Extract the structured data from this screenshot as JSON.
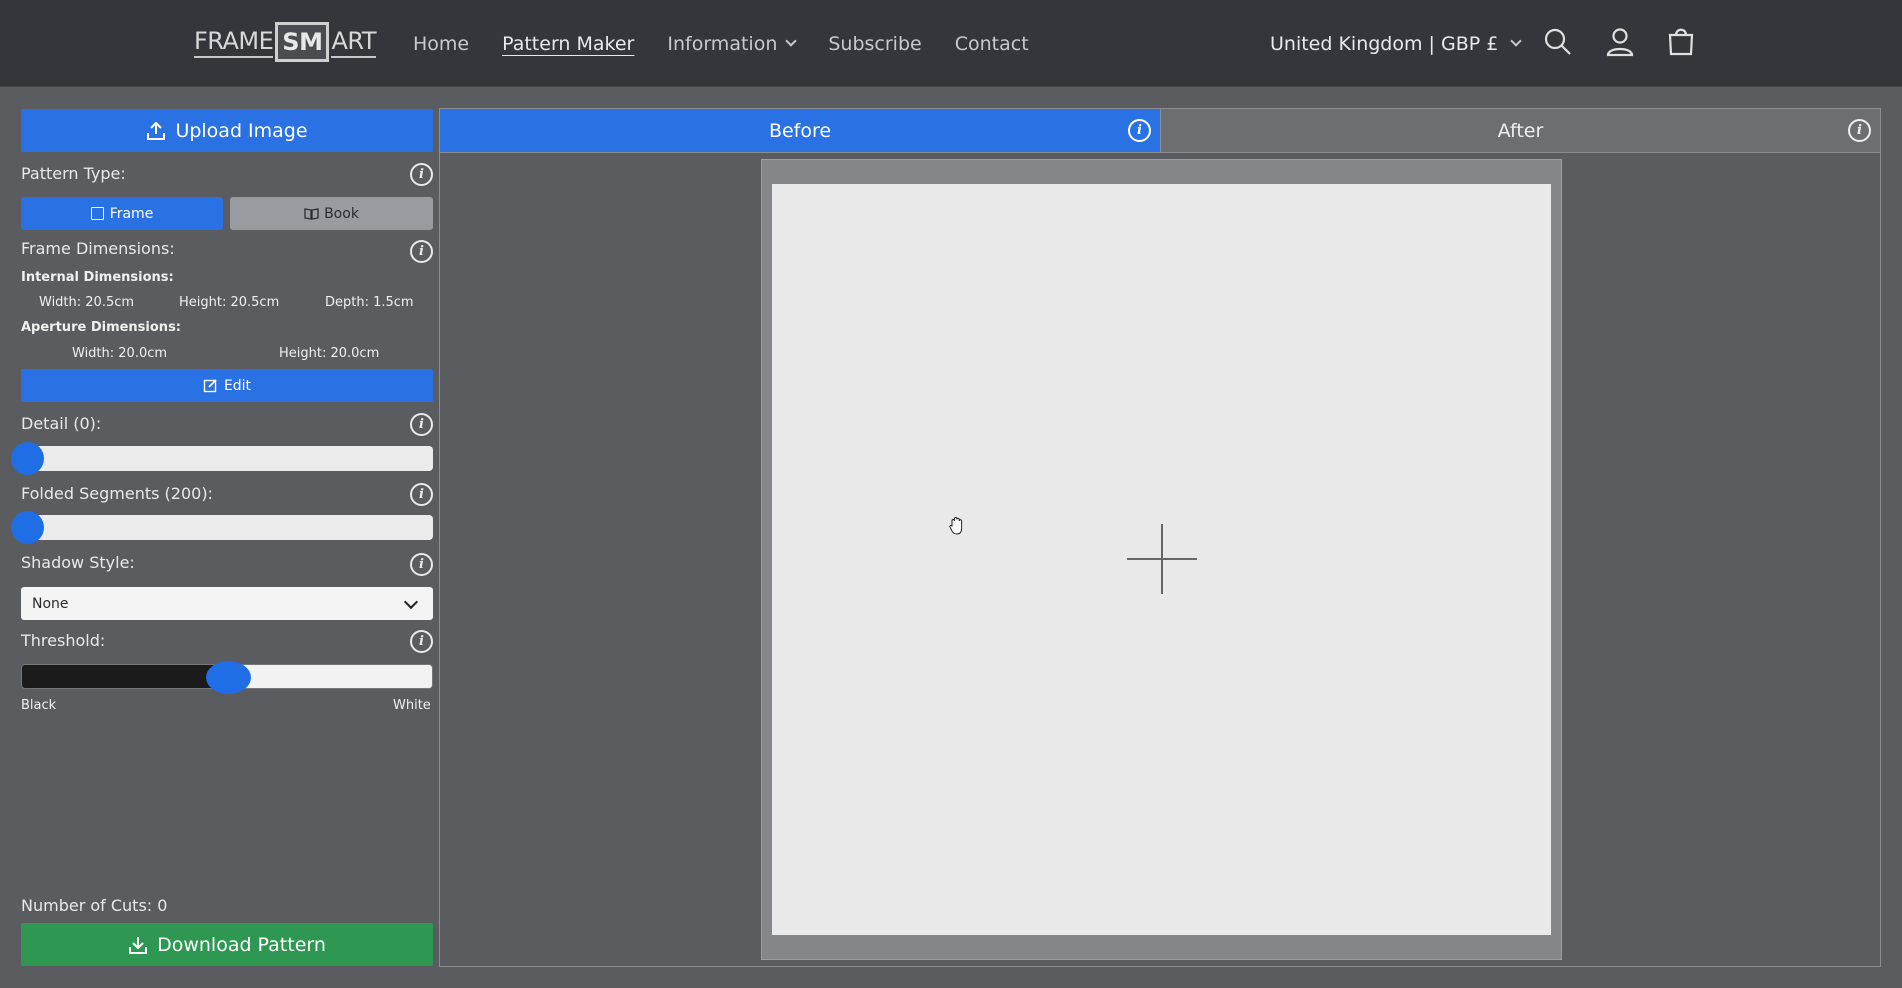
{
  "header": {
    "logo": {
      "part1": "FRAME",
      "part2": "SM",
      "part3": "ART"
    },
    "nav": [
      {
        "label": "Home"
      },
      {
        "label": "Pattern Maker",
        "active": true
      },
      {
        "label": "Information",
        "dropdown": true
      },
      {
        "label": "Subscribe"
      },
      {
        "label": "Contact"
      }
    ],
    "region": "United Kingdom | GBP £",
    "icons": [
      "search-icon",
      "account-icon",
      "cart-icon"
    ]
  },
  "sidebar": {
    "upload_label": "Upload Image",
    "pattern_type_label": "Pattern Type:",
    "pattern_frame": "Frame",
    "pattern_book": "Book",
    "frame_dimensions_label": "Frame Dimensions:",
    "internal_label": "Internal Dimensions:",
    "internal_width": "Width: 20.5cm",
    "internal_height": "Height: 20.5cm",
    "internal_depth": "Depth: 1.5cm",
    "aperture_label": "Aperture Dimensions:",
    "aperture_width": "Width: 20.0cm",
    "aperture_height": "Height: 20.0cm",
    "edit_label": "Edit",
    "detail_label": "Detail (0):",
    "detail_value": 0,
    "folded_label": "Folded Segments (200):",
    "folded_value": 200,
    "shadow_label": "Shadow Style:",
    "shadow_selected": "None",
    "threshold_label": "Threshold:",
    "threshold_fraction": 0.5,
    "threshold_min": "Black",
    "threshold_max": "White",
    "cuts_label": "Number of Cuts: 0",
    "download_label": "Download Pattern"
  },
  "main": {
    "tab_before": "Before",
    "tab_after": "After",
    "active_tab": "Before"
  },
  "colors": {
    "accent_blue": "#2a71e3",
    "download_green": "#2e9853",
    "header_bg": "#34363c",
    "page_bg": "#5b5c5f"
  }
}
